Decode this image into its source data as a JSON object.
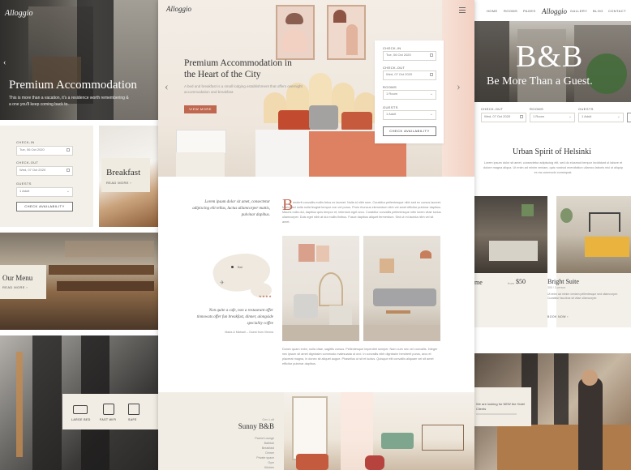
{
  "left": {
    "logo": "Alloggio",
    "hero_title": "Premium Accommodation",
    "hero_text": "This is more than a vacation, it's a residence worth remembering & a one you'll keep coming back to.",
    "form": {
      "checkin_label": "CHECK-IN",
      "checkin_value": "Tue, 06 Oct 2020",
      "checkout_label": "CHECK-OUT",
      "checkout_value": "Wed, 07 Oct 2020",
      "guests_label": "GUESTS",
      "guests_value": "1 Adult",
      "button": "CHECK AVAILABILITY"
    },
    "breakfast_title": "Breakfast",
    "breakfast_link": "READ MORE",
    "menu_title": "Our Menu",
    "menu_link": "READ MORE",
    "amenities": [
      "LARGE BED",
      "FAST WIFI",
      "SAFE"
    ]
  },
  "center": {
    "hero_title_line1": "Premium Accommodation in",
    "hero_title_line2": "the Heart of the City",
    "hero_text": "A bed and breakfast is a small lodging establishment that offers overnight accommodation and breakfast.",
    "hero_button": "VIEW MORE",
    "booking": {
      "checkin_label": "CHECK-IN",
      "checkin_value": "Tue, 06 Oct 2020",
      "checkout_label": "CHECK-OUT",
      "checkout_value": "Wed, 07 Oct 2020",
      "rooms_label": "ROOMS",
      "rooms_value": "1 Room",
      "guests_label": "GUESTS",
      "guests_value": "1 Adult",
      "button": "CHECK AVAILABILITY"
    },
    "intro_left": "Lorem ipsum dolor sit amet, consectetur adipiscing elit tellus, luctus ullamcorper mattis, pulvinar dapibus.",
    "dropcap": "B",
    "intro_right": "enderit convallis mollis fetus ex laoreet. Nulla id nibh sem. Curabitur pellentesque nibh sed ex cursus laoreet. Morbi sed nulla nulla feugiat tempor non vel purus. Proin rhoncus elementum nibh vel amet efficitur pulvinar dapibus. Mauris nulla dui, dapibus quis tempor et, interdum eget arcu. Curabitur convallis pellentesque nibh lorem vitae luctus ullamcorper. Duis eget nibh at dui mollis finibus. Fusce dapibus aliquet fermentum. Sed ut mi lacinia nibh vel sit amet.",
    "map_label": "Bal",
    "quote": "Non quite a cafe, non a restaurant offer tinnowats offer fun breakfast, dinner, alongside speciality coffee",
    "quote_author": "Maria & Michael – Guest from Vienna",
    "body_text": "Donec quam enim, nulla vitae, sagittis cursus. Pellentesque imperdiet semper. Nam cum nec vel convallis. Integer nec ipsum sit amet dignissim commodo malesuada ut orci. In convallis nibh dignissim hendrerit purus, arcu et placerat magna, in donec sit aliquet augue. Phasellus ut sit et luctus. Quisque elit convallis aliquam vel sit amet efficitur pulvinar dapibus.",
    "sunny_kicker": "Gen Loft",
    "sunny_title": "Sunny B&B",
    "sunny_list": [
      "Parent Lounge",
      "Bathtub",
      "Breakfast",
      "Dinner",
      "Private space",
      "Gym",
      "Kitchen"
    ]
  },
  "right": {
    "nav": [
      "HOME",
      "ROOMS",
      "PAGES"
    ],
    "nav_right": [
      "GALLERY",
      "BLOG",
      "CONTACT"
    ],
    "logo": "Alloggio",
    "hero_big": "B&B",
    "hero_sub": "Be More Than a Guest.",
    "form": {
      "checkout_label": "CHECK-OUT",
      "checkout_value": "Wed, 07 Oct 2020",
      "rooms_label": "ROOMS",
      "rooms_value": "1 Room",
      "guests_label": "GUESTS",
      "guests_value": "1 Adult"
    },
    "section_title": "Urban Spirit of Helsinki",
    "section_text": "Lorem ipsum dolor sit amet, consectetur adipiscing elit, sed do eiusmod tempor incididunt ut labore et dolore magna aliqua. Ut enim ad minim veniam, quis nostrud exercitation ullamco laboris nisi ut aliquip ex ea commodo consequat.",
    "room1_name": "ome",
    "room1_from": "from",
    "room1_price": "$50",
    "room2_name": "Bright Suite",
    "room2_meta": "300 / 3 person",
    "room2_text": "Ut enim ad minim veniam pellentesque sed ullamcorper. Curabitur faucibus sit vitae ullamcorper.",
    "room2_link": "BOOK NOW",
    "promo_text": "We are looking for NEW the Hotel Clients"
  },
  "colors": {
    "accent": "#c0674f",
    "beige": "#f1ede5",
    "dark": "#2b2b2b"
  }
}
